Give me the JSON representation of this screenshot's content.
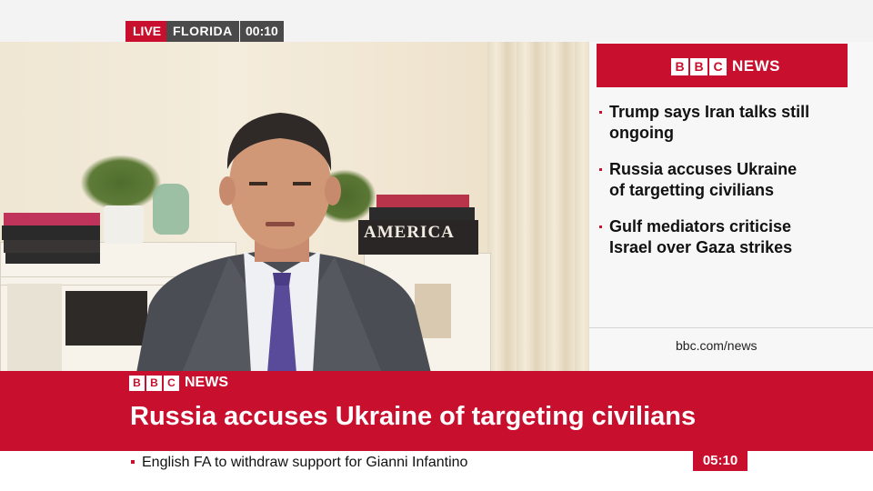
{
  "top_bar": {
    "live_label": "LIVE",
    "location": "FLORIDA",
    "clock": "00:10"
  },
  "video": {
    "book_title": "AMERICA"
  },
  "sidebar": {
    "brand_blocks": [
      "B",
      "B",
      "C"
    ],
    "brand_news": "NEWS",
    "headlines": [
      "Trump says Iran talks still ongoing",
      "Russia accuses Ukraine of targetting civilians",
      "Gulf mediators criticise Israel over Gaza strikes"
    ],
    "url": "bbc.com/news"
  },
  "lower_third": {
    "brand_blocks": [
      "B",
      "B",
      "C"
    ],
    "brand_news": "NEWS",
    "headline": "Russia accuses Ukraine of targeting civilians"
  },
  "ticker": {
    "text": "English FA to withdraw support for Gianni Infantino",
    "time": "05:10"
  },
  "colors": {
    "brand_red": "#c8102e",
    "badge_gray": "#4a4a4a"
  }
}
